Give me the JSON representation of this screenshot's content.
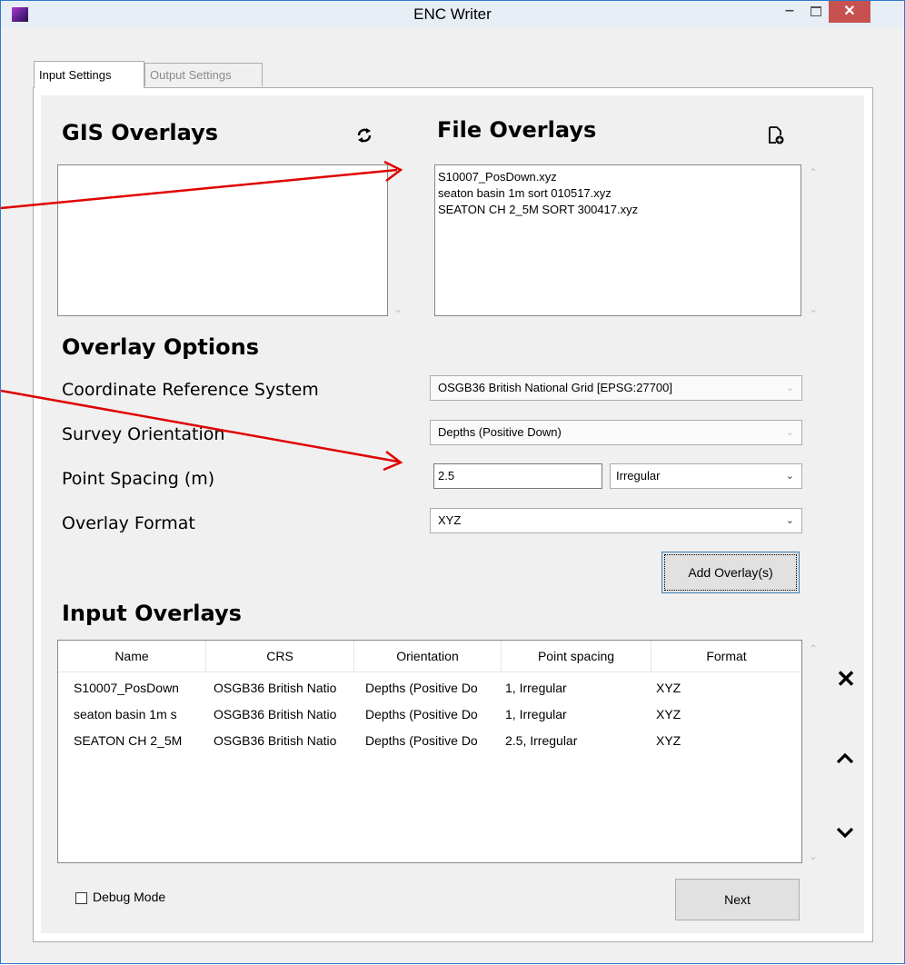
{
  "window": {
    "title": "ENC Writer"
  },
  "tabs": [
    {
      "label": "Input Settings",
      "active": true
    },
    {
      "label": "Output Settings",
      "active": false
    }
  ],
  "gis_overlays": {
    "title": "GIS Overlays",
    "items": []
  },
  "file_overlays": {
    "title": "File Overlays",
    "items": [
      "S10007_PosDown.xyz",
      "seaton basin 1m sort 010517.xyz",
      "SEATON CH 2_5M SORT 300417.xyz"
    ]
  },
  "overlay_options": {
    "title": "Overlay Options",
    "crs_label": "Coordinate Reference System",
    "crs_value": "OSGB36 British National Grid [EPSG:27700]",
    "orientation_label": "Survey Orientation",
    "orientation_value": "Depths  (Positive Down)",
    "spacing_label": "Point Spacing (m)",
    "spacing_value": "2.5",
    "spacing_type": "Irregular",
    "format_label": "Overlay Format",
    "format_value": "XYZ",
    "add_button": "Add Overlay(s)"
  },
  "input_overlays": {
    "title": "Input Overlays",
    "columns": [
      "Name",
      "CRS",
      "Orientation",
      "Point spacing",
      "Format"
    ],
    "rows": [
      [
        "S10007_PosDown",
        "OSGB36 British Natio",
        "Depths  (Positive Do",
        "1, Irregular",
        "XYZ"
      ],
      [
        "seaton basin 1m s",
        "OSGB36 British Natio",
        "Depths  (Positive Do",
        "1, Irregular",
        "XYZ"
      ],
      [
        "SEATON CH 2_5M",
        "OSGB36 British Natio",
        "Depths  (Positive Do",
        "2.5, Irregular",
        "XYZ"
      ]
    ]
  },
  "footer": {
    "debug_label": "Debug Mode",
    "debug_checked": false,
    "next_button": "Next"
  },
  "colors": {
    "annotation_arrow": "#e00000",
    "titlebar_close": "#c75050"
  }
}
